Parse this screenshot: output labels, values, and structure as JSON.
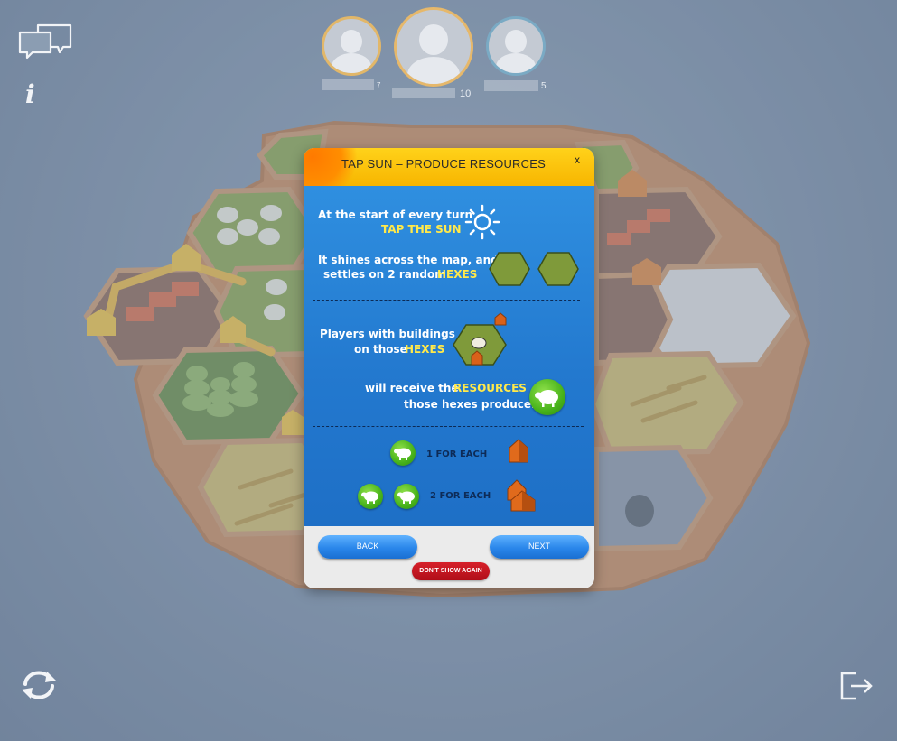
{
  "players": [
    {
      "name": "",
      "score": "7"
    },
    {
      "name": "",
      "score": "10"
    },
    {
      "name": "",
      "score": "5"
    }
  ],
  "tutorial": {
    "title": "TAP SUN – PRODUCE RESOURCES",
    "close": "x",
    "line1": "At the start of every turn",
    "line1_hl": "TAP THE SUN",
    "line2": "It shines across the map, and",
    "line3": "settles on 2 random",
    "line3_hl": "HEXES",
    "line4": "Players with buildings",
    "line5": "on those",
    "line5_hl": "HEXES",
    "line6": "will receive the",
    "line6_hl": "RESOURCES",
    "line7": "those hexes produce.",
    "rule1": "1  FOR EACH",
    "rule2": "2  FOR EACH",
    "back_label": "BACK",
    "next_label": "NEXT",
    "dont_show_label": "DON'T SHOW AGAIN"
  },
  "icons": {
    "chat": "chat-bubbles-icon",
    "info": "info-icon",
    "refresh": "refresh-icon",
    "exit": "exit-icon",
    "sun": "sun-icon",
    "sheep": "sheep-icon",
    "house": "house-icon",
    "city": "city-icon"
  },
  "colors": {
    "header": "#f7b500",
    "body": "#2379cf",
    "highlight": "#ffe94a",
    "dont_show": "#c0141f",
    "button": "#2a86ea"
  }
}
